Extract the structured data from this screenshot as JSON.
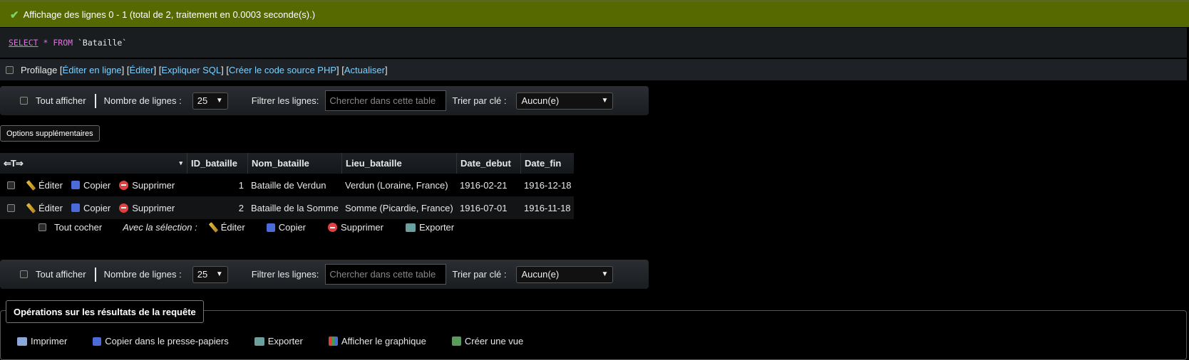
{
  "success_message": "Affichage des lignes 0 - 1 (total de 2, traitement en 0.0003 seconde(s).)",
  "sql": {
    "select": "SELECT",
    "star": "*",
    "from": "FROM",
    "table": "`Bataille`"
  },
  "profbar": {
    "profilage": "Profilage",
    "links": [
      "Éditer en ligne",
      "Éditer",
      "Expliquer SQL",
      "Créer le code source PHP",
      "Actualiser"
    ]
  },
  "navbar": {
    "show_all": "Tout afficher",
    "rows_label": "Nombre de lignes :",
    "rows_value": "25",
    "filter_label": "Filtrer les lignes:",
    "filter_placeholder": "Chercher dans cette table",
    "sort_label": "Trier par clé :",
    "sort_value": "Aucun(e)"
  },
  "options_button": "Options supplémentaires",
  "table": {
    "columns": [
      "ID_bataille",
      "Nom_bataille",
      "Lieu_bataille",
      "Date_debut",
      "Date_fin"
    ],
    "actions": {
      "edit": "Éditer",
      "copy": "Copier",
      "delete": "Supprimer"
    },
    "rows": [
      [
        "1",
        "Bataille de Verdun",
        "Verdun (Loraine, France)",
        "1916-02-21",
        "1916-12-18"
      ],
      [
        "2",
        "Bataille de la Somme",
        "Somme (Picardie, France)",
        "1916-07-01",
        "1916-11-18"
      ]
    ]
  },
  "bulk": {
    "check_all": "Tout cocher",
    "with_selection": "Avec la sélection :",
    "edit": "Éditer",
    "copy": "Copier",
    "delete": "Supprimer",
    "export": "Exporter"
  },
  "operations": {
    "legend": "Opérations sur les résultats de la requête",
    "print": "Imprimer",
    "copy_clipboard": "Copier dans le presse-papiers",
    "export": "Exporter",
    "chart": "Afficher le graphique",
    "create_view": "Créer une vue"
  }
}
